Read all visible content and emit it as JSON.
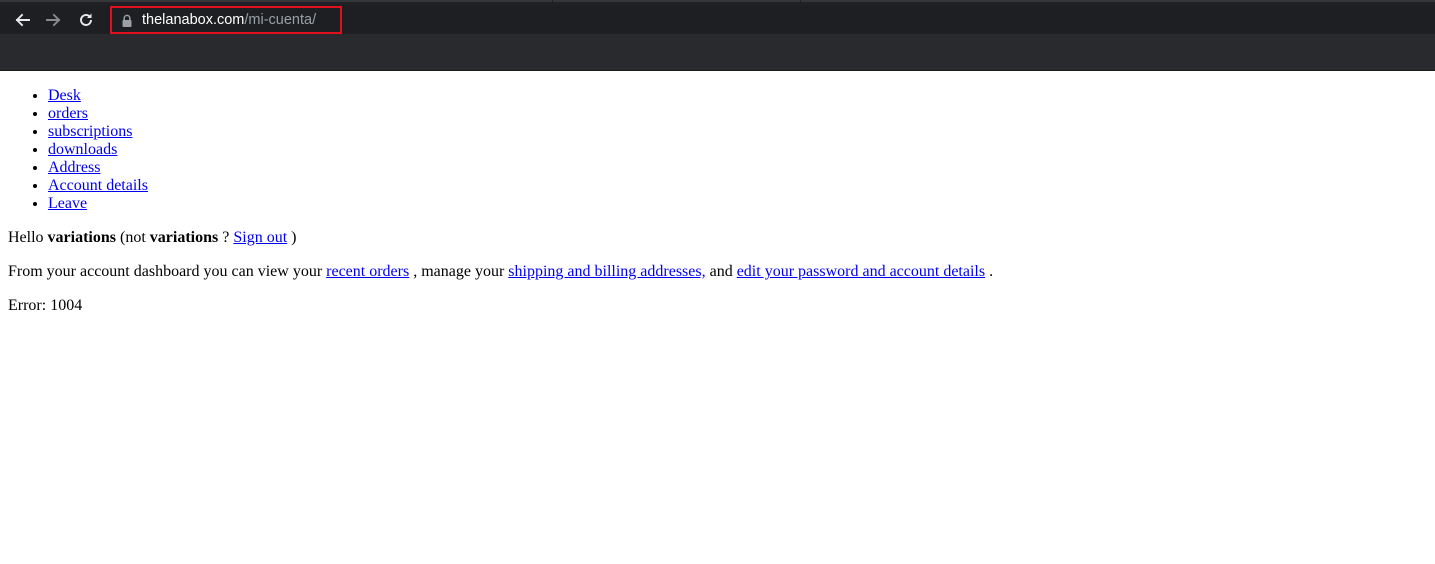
{
  "browser": {
    "url_host": "thelanabox.com",
    "url_path": "/mi-cuenta/",
    "icons": [
      "back-arrow-icon",
      "forward-arrow-icon",
      "reload-icon",
      "lock-icon"
    ]
  },
  "nav": {
    "items": [
      {
        "label": "Desk"
      },
      {
        "label": "orders"
      },
      {
        "label": "subscriptions"
      },
      {
        "label": "downloads"
      },
      {
        "label": "Address"
      },
      {
        "label": "Account details"
      },
      {
        "label": "Leave"
      }
    ]
  },
  "greeting": {
    "hello": "Hello",
    "username": "variations",
    "not_prefix": "(not",
    "username2": "variations",
    "question": "?",
    "sign_out": "Sign out",
    "close_paren": ")"
  },
  "dashboard": {
    "text1": "From your account dashboard you can view your",
    "link_recent_orders": "recent orders",
    "text2": ", manage your",
    "link_addresses": "shipping and billing addresses,",
    "text3": "and",
    "link_edit": "edit your password and account details",
    "text4": "."
  },
  "error": {
    "text": "Error: 1004"
  }
}
